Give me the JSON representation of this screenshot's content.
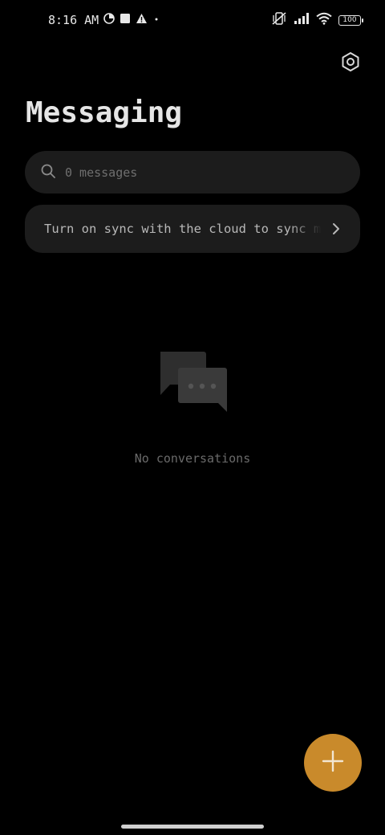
{
  "status_bar": {
    "time": "8:16 AM",
    "battery": "100",
    "icons": [
      "data-saver-icon",
      "square-notification-icon",
      "warning-icon",
      "dot-icon",
      "vibrate-off-icon",
      "signal-icon",
      "wifi-icon",
      "battery-icon"
    ]
  },
  "header": {
    "title": "Messaging",
    "settings_icon": "settings-hex-icon"
  },
  "search": {
    "placeholder": "0 messages",
    "icon": "search-icon"
  },
  "sync_banner": {
    "text": "Turn on sync with the cloud to sync messages",
    "icon": "chevron-right-icon"
  },
  "empty_state": {
    "icon": "chat-bubbles-icon",
    "text": "No conversations"
  },
  "fab": {
    "icon": "plus-icon",
    "color": "#c98a2b"
  },
  "colors": {
    "background": "#000000",
    "surface": "#1c1c1c",
    "accent": "#c98a2b"
  }
}
